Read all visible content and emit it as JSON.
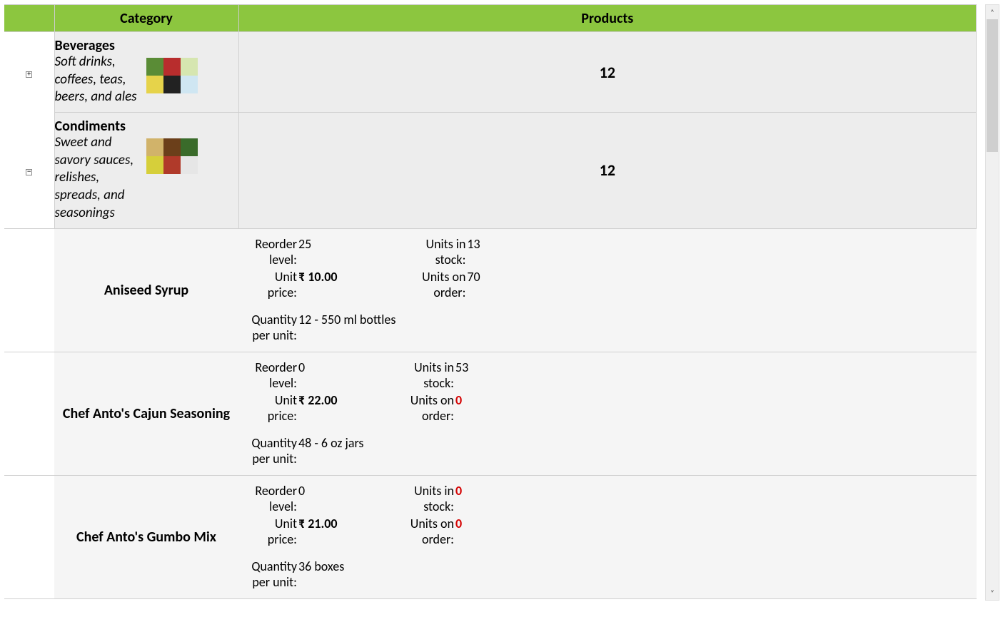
{
  "columns": {
    "category": "Category",
    "products": "Products"
  },
  "categories": [
    {
      "name": "Beverages",
      "desc": "Soft drinks, coffees, teas, beers, and ales",
      "count": "12",
      "expanded": false,
      "img_colors": [
        "#5a8c36",
        "#b82d2d",
        "#d6e6b0",
        "#e6d34a",
        "#222",
        "#cfe6f2"
      ]
    },
    {
      "name": "Condiments",
      "desc": "Sweet and savory sauces, relishes, spreads, and seasonings",
      "count": "12",
      "expanded": true,
      "img_colors": [
        "#d1b36a",
        "#6b3f1a",
        "#3a6b2a",
        "#d6cf3a",
        "#b03a2a",
        "#e6e6e6"
      ],
      "products": [
        {
          "name": "Aniseed Syrup",
          "reorder_level": "25",
          "unit_price": "₹ 10.00",
          "qty_per_unit": "12 - 550 ml bottles",
          "units_in_stock": "13",
          "uis_red": false,
          "units_on_order": "70",
          "uoo_red": false
        },
        {
          "name": "Chef Anto's Cajun Seasoning",
          "reorder_level": "0",
          "unit_price": "₹ 22.00",
          "qty_per_unit": "48 - 6 oz jars",
          "units_in_stock": "53",
          "uis_red": false,
          "units_on_order": "0",
          "uoo_red": true
        },
        {
          "name": "Chef Anto's Gumbo Mix",
          "reorder_level": "0",
          "unit_price": "₹ 21.00",
          "qty_per_unit": "36 boxes",
          "units_in_stock": "0",
          "uis_red": true,
          "units_on_order": "0",
          "uoo_red": true
        }
      ]
    }
  ],
  "labels": {
    "reorder_level": "Reorder level:",
    "unit_price": "Unit price:",
    "qty_per_unit": "Quantity per unit:",
    "units_in_stock": "Units in stock:",
    "units_on_order": "Units on order:"
  },
  "expand_glyph": {
    "collapsed": "+",
    "expanded": "−"
  },
  "scroll": {
    "up": "˄",
    "down": "˅"
  }
}
